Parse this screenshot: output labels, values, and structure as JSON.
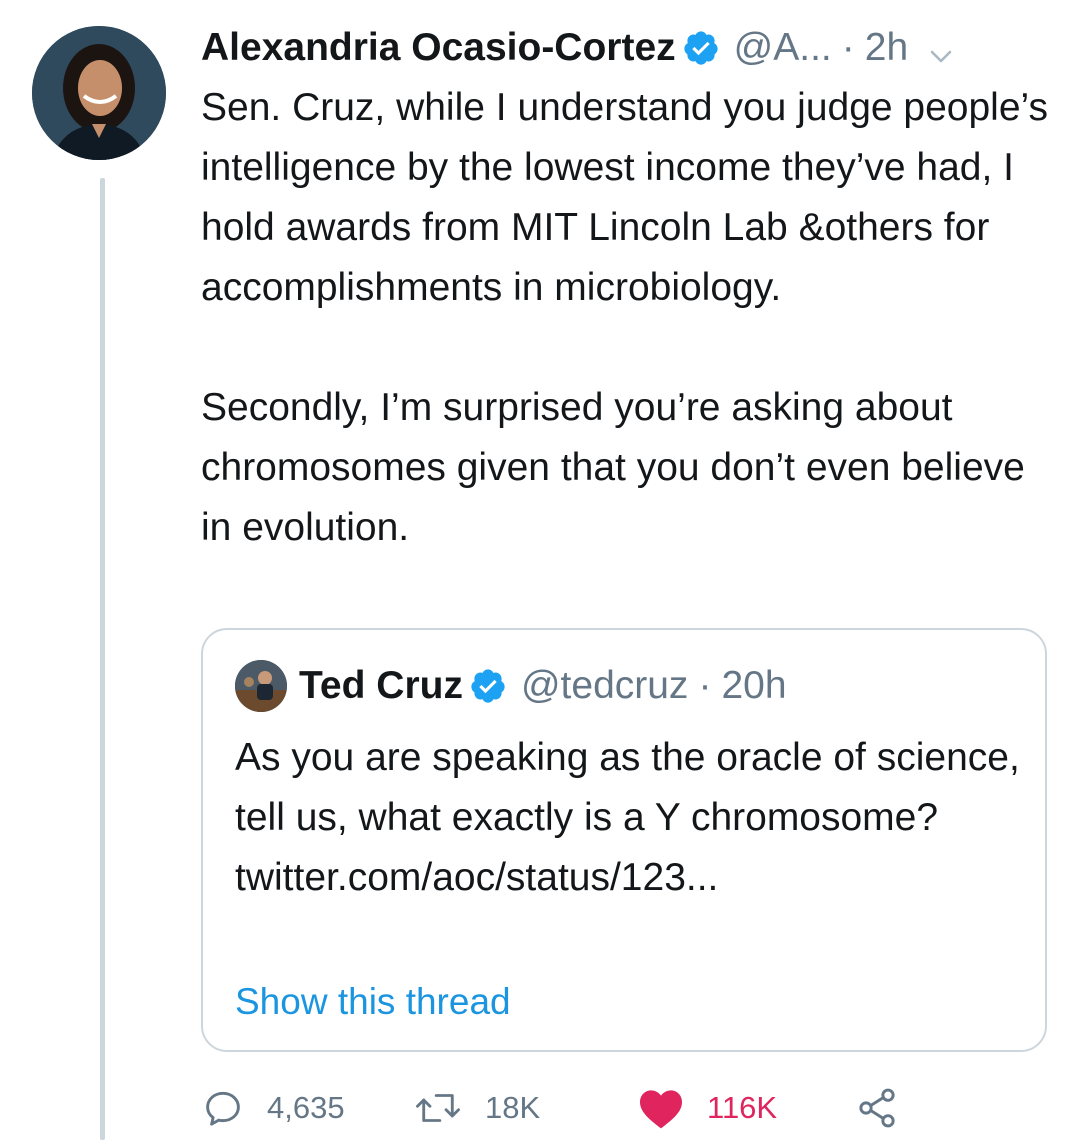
{
  "tweet": {
    "author_name": "Alexandria Ocasio-Cortez",
    "handle": "@A...",
    "separator": "·",
    "time": "2h",
    "text": "Sen. Cruz, while I understand you judge people’s intelligence by the lowest income they’ve had, I hold awards from MIT Lincoln Lab &others for accomplishments in microbiology.\n\nSecondly, I’m surprised you’re asking about chromosomes given that you don’t even believe in evolution."
  },
  "quoted": {
    "author_name": "Ted Cruz",
    "handle": "@tedcruz",
    "separator": "·",
    "time": "20h",
    "text": "As you are speaking as the oracle of science, tell us, what exactly is a Y chromosome? twitter.com/aoc/status/123...",
    "show_thread": "Show this thread"
  },
  "actions": {
    "replies": "4,635",
    "retweets": "18K",
    "likes": "116K"
  },
  "colors": {
    "verified": "#1da1f2",
    "link": "#1b95e0",
    "like": "#e0245e",
    "muted": "#657786",
    "border": "#ccd6dd"
  },
  "icons": [
    "verified-badge-icon",
    "chevron-down-icon",
    "reply-icon",
    "retweet-icon",
    "heart-icon",
    "share-icon"
  ]
}
